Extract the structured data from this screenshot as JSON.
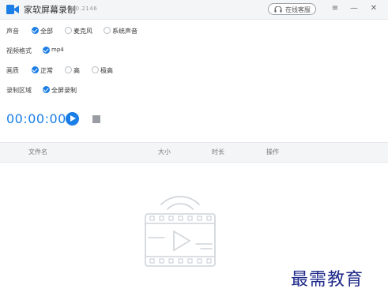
{
  "app": {
    "title": "家软屏幕录制",
    "version": "1.0.2146",
    "service_button": "在线客服",
    "window_controls": {
      "menu": "≡",
      "minimize": "—",
      "close": "✕"
    }
  },
  "settings": {
    "sound": {
      "label": "声音",
      "options": [
        "全部",
        "麦克风",
        "系统声音"
      ],
      "selected": "全部"
    },
    "format": {
      "label": "视频格式",
      "options": [
        "mp4"
      ],
      "selected": "mp4"
    },
    "quality": {
      "label": "画质",
      "options": [
        "正常",
        "高",
        "极高"
      ],
      "selected": "正常"
    },
    "area": {
      "label": "录制区域",
      "options": [
        "全屏录制"
      ],
      "selected": "全屏录制"
    }
  },
  "recorder": {
    "timer": "00:00:00"
  },
  "table": {
    "columns": [
      "文件名",
      "大小",
      "时长",
      "操作"
    ]
  },
  "watermark": "最需教育",
  "colors": {
    "accent": "#1a7ee6",
    "titlebar": "#f4f5f7",
    "watermark": "#1f2a8a"
  }
}
